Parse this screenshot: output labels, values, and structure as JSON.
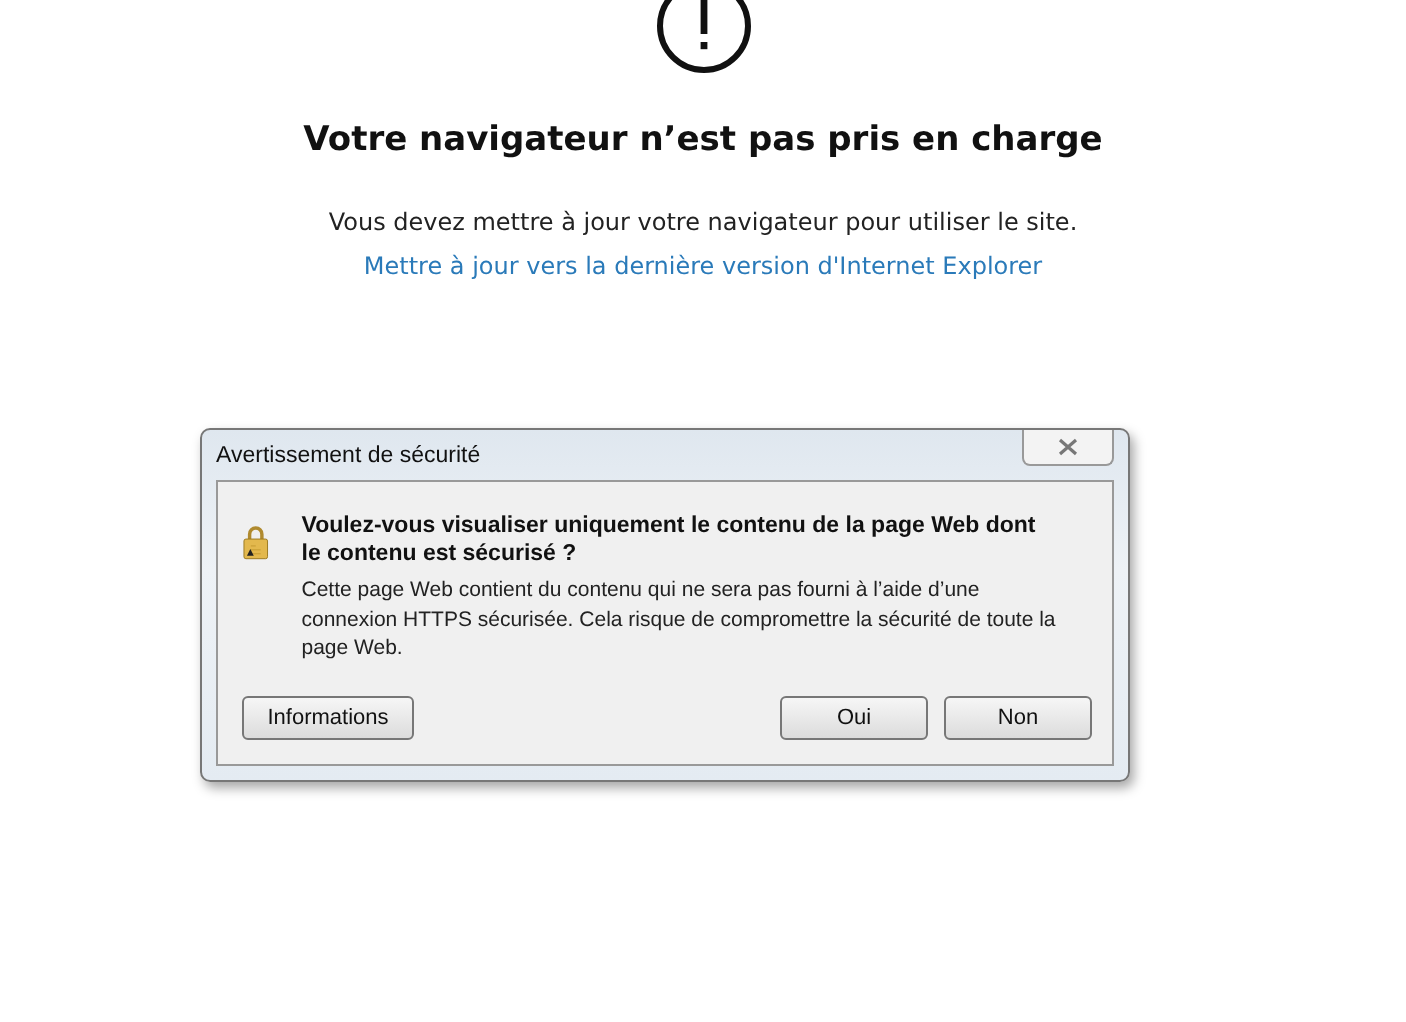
{
  "page": {
    "heading": "Votre navigateur n’est pas pris en charge",
    "message": "Vous devez mettre à jour votre navigateur pour utiliser le site.",
    "link": "Mettre à jour vers la dernière version d'Internet Explorer"
  },
  "dialog": {
    "title": "Avertissement de sécurité",
    "question": "Voulez-vous visualiser uniquement le contenu de la page Web dont le contenu est sécurisé ?",
    "details": "Cette page Web contient du contenu qui ne sera pas fourni à l’aide d’une connexion HTTPS sécurisée. Cela risque de compromettre la sécurité de toute la page Web.",
    "buttons": [
      {
        "label": "Informations",
        "kind": "left"
      },
      {
        "label": "Oui",
        "kind": "right"
      },
      {
        "label": "Non",
        "kind": "right"
      }
    ]
  }
}
